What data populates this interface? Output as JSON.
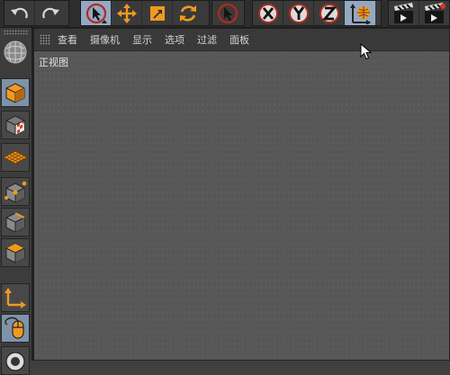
{
  "toolbar": {
    "icons": [
      "undo-icon",
      "redo-icon",
      "live-selection-icon",
      "move-icon",
      "scale-icon",
      "rotate-icon",
      "recent-tool-icon",
      "x-axis-icon",
      "y-axis-icon",
      "z-axis-icon",
      "world-coordinates-icon",
      "render-view-icon",
      "render-to-picture-viewer-icon"
    ]
  },
  "viewport": {
    "menu": [
      "查看",
      "摄像机",
      "显示",
      "选项",
      "过滤",
      "面板"
    ],
    "view_name": "正视图"
  },
  "colors": {
    "accent_orange": "#f09a1a",
    "active_blue": "#93a9c3",
    "viewport_bg": "#575757",
    "axis_red": "#b12a1e"
  },
  "left_toolbar": {
    "icons": [
      "make-editable-icon",
      "model-mode-icon",
      "texture-mode-icon",
      "workplane-mode-icon",
      "points-mode-icon",
      "edges-mode-icon",
      "polygons-mode-icon",
      "axis-mode-icon",
      "tweak-mode-icon",
      "solo-icon"
    ]
  }
}
